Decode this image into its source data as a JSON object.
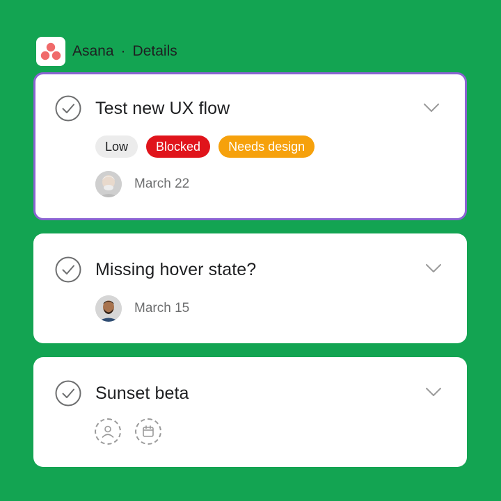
{
  "header": {
    "app_name": "Asana",
    "separator": "·",
    "section": "Details",
    "logo_icon": "asana-logo"
  },
  "colors": {
    "background": "#13a452",
    "selected_border": "#8a63d2",
    "tag_low_bg": "#ececec",
    "tag_blocked_bg": "#e0141b",
    "tag_needs_design_bg": "#f6a10c"
  },
  "tasks": [
    {
      "title": "Test new UX flow",
      "selected": true,
      "tags": [
        {
          "label": "Low"
        },
        {
          "label": "Blocked"
        },
        {
          "label": "Needs design"
        }
      ],
      "date": "March 22",
      "avatar_icon": "avatar-older-man"
    },
    {
      "title": "Missing hover state?",
      "selected": false,
      "date": "March 15",
      "avatar_icon": "avatar-bearded-man"
    },
    {
      "title": "Sunset beta",
      "selected": false,
      "empty_assignee_icon": "assignee-placeholder-icon",
      "empty_date_icon": "calendar-placeholder-icon"
    }
  ]
}
